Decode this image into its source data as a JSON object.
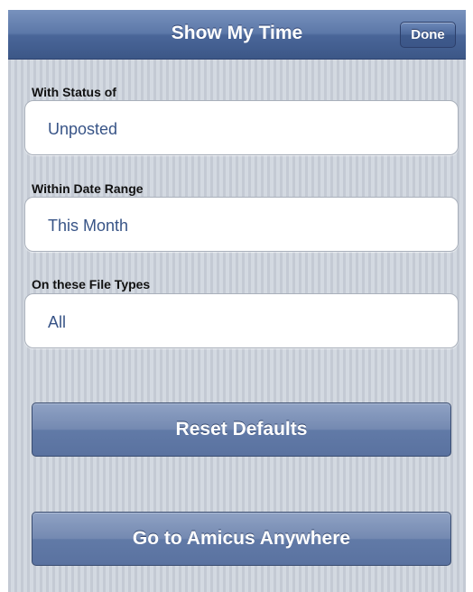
{
  "navbar": {
    "title": "Show My Time",
    "done_label": "Done"
  },
  "filters": {
    "status": {
      "label": "With Status of",
      "value": "Unposted"
    },
    "date_range": {
      "label": "Within Date Range",
      "value": "This Month"
    },
    "file_types": {
      "label": "On these File Types",
      "value": "All"
    }
  },
  "buttons": {
    "reset_label": "Reset Defaults",
    "amicus_label": "Go to Amicus Anywhere"
  },
  "colors": {
    "navbar": "#4a6699",
    "field_value_text": "#385487",
    "button": "#6f84ad"
  }
}
